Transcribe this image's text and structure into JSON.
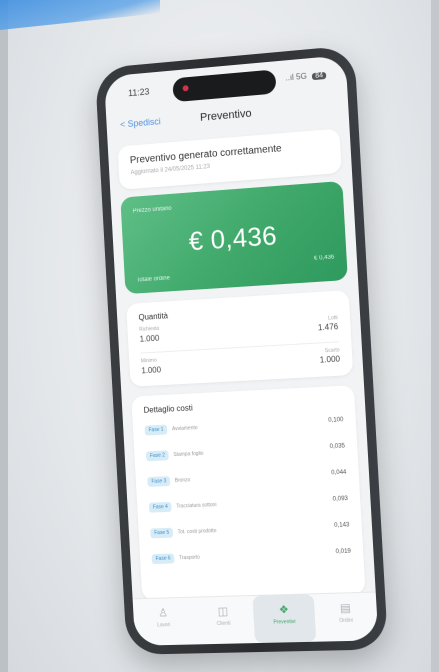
{
  "status_bar": {
    "time": "11:23",
    "signal": "..ıl 5G",
    "battery": "84"
  },
  "nav": {
    "back_label": "< Spedisci",
    "title": "Preventivo"
  },
  "success": {
    "title": "Preventivo generato correttamente",
    "subtitle": "Aggiornato il 24/05/2025 11:23"
  },
  "price": {
    "label": "Prezzo unitario",
    "value": "€ 0,436",
    "secondary_right": "€ 0,436",
    "secondary_left": "Totale ordine"
  },
  "quantity": {
    "title": "Quantità",
    "rows": [
      {
        "label": "Richiesta",
        "value": "1.000",
        "right_label": "Lotti",
        "right_value": "1.476"
      },
      {
        "label": "Minimo",
        "value": "1.000",
        "right_label": "Scarto",
        "right_value": "1.000"
      }
    ]
  },
  "costs": {
    "title": "Dettaglio costi",
    "rows": [
      {
        "phase": "Fase 1",
        "desc": "Avviamento",
        "value": "0,100"
      },
      {
        "phase": "Fase 2",
        "desc": "Stampa foglio",
        "value": "0,035"
      },
      {
        "phase": "Fase 3",
        "desc": "Bronzo",
        "value": "0,044"
      },
      {
        "phase": "Fase 4",
        "desc": "Tracciatura sottoni",
        "value": "0,093"
      },
      {
        "phase": "Fase 5",
        "desc": "Tot. costi prodotto",
        "value": "0,143"
      },
      {
        "phase": "Fase 6",
        "desc": "Trasporto",
        "value": "0,019"
      }
    ]
  },
  "tabs": [
    {
      "label": "Lavori",
      "icon": "people-icon",
      "glyph": "♙",
      "active": false
    },
    {
      "label": "Clienti",
      "icon": "chat-icon",
      "glyph": "◫",
      "active": false
    },
    {
      "label": "Preventivi",
      "icon": "quote-icon",
      "glyph": "❖",
      "active": true
    },
    {
      "label": "Ordini",
      "icon": "box-icon",
      "glyph": "▤",
      "active": false
    }
  ],
  "colors": {
    "accent_green": "#3fa86a",
    "link_blue": "#4f93df",
    "badge_bg": "#d8ecf7"
  }
}
